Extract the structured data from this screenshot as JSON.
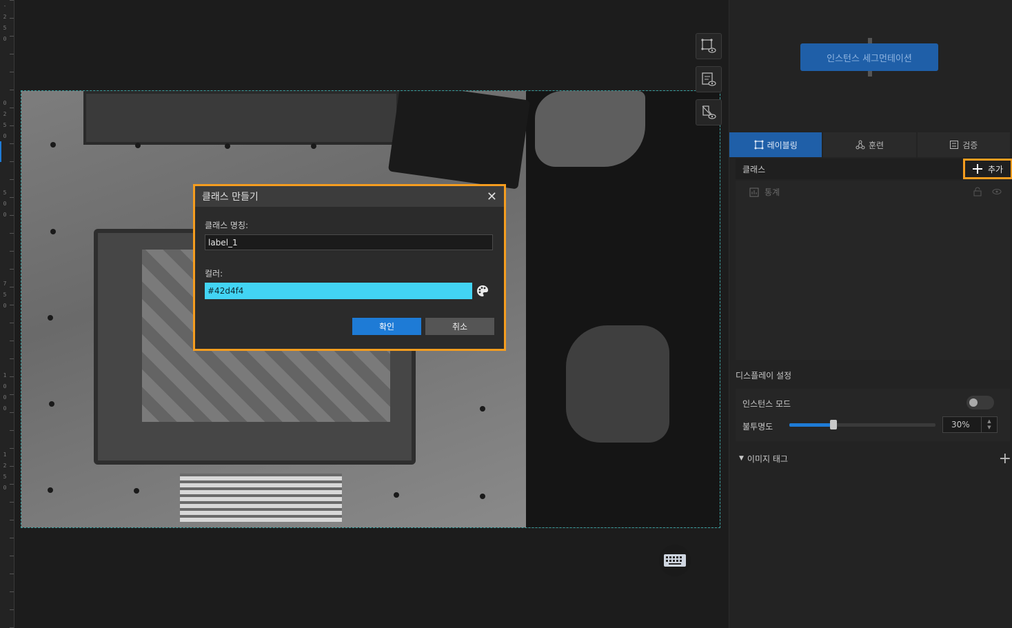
{
  "ruler": {
    "ticks": [
      "-",
      "2",
      "5",
      "0",
      "0",
      "2",
      "5",
      "0",
      "5",
      "0",
      "0",
      "7",
      "5",
      "0",
      "1",
      "0",
      "0",
      "0",
      "1",
      "2",
      "5",
      "0"
    ]
  },
  "dialog": {
    "title": "클래스 만들기",
    "close_icon": "close-icon",
    "name_label": "클래스 명칭:",
    "name_value": "label_1",
    "color_label": "컬러:",
    "color_value": "#42d4f4",
    "ok_label": "확인",
    "cancel_label": "취소"
  },
  "workflow": {
    "node_label": "인스턴스 세그먼테이션"
  },
  "tabs": [
    {
      "label": "레이블링",
      "icon": "labeling-icon",
      "active": true
    },
    {
      "label": "훈련",
      "icon": "training-icon",
      "active": false
    },
    {
      "label": "검증",
      "icon": "validation-icon",
      "active": false
    }
  ],
  "classes": {
    "title": "클래스",
    "add_label": "추가",
    "stats_label": "통계"
  },
  "display": {
    "title": "디스플레이 설정",
    "instance_mode_label": "인스턴스 모드",
    "instance_mode_on": false,
    "opacity_label": "불투명도",
    "opacity_value": "30%",
    "opacity_fraction": 0.3
  },
  "image_tags": {
    "title": "이미지 태그"
  },
  "colors": {
    "accent": "#1e7bd6",
    "highlight": "#f59d1f",
    "class_color": "#42d4f4"
  }
}
